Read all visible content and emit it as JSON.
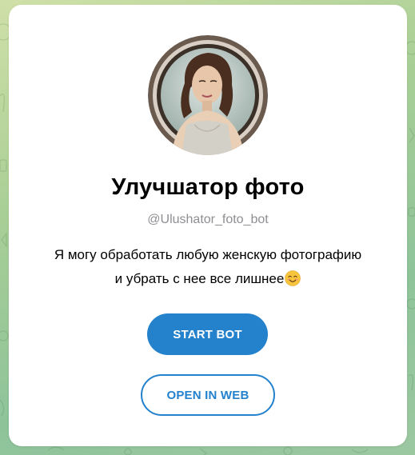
{
  "bot": {
    "name": "Улучшатор фото",
    "username": "@Ulushator_foto_bot",
    "description_line1": "Я могу обработать любую женскую фотографию",
    "description_line2": "и убрать с нее все лишнее"
  },
  "buttons": {
    "start_label": "START BOT",
    "web_label": "OPEN IN WEB"
  },
  "icons": {
    "avatar": "bot-avatar-portrait",
    "emoji": "smiling-face-emoji"
  },
  "colors": {
    "accent": "#2481cc",
    "username": "#8e8e93",
    "card": "#ffffff",
    "background": "#a9cf96"
  }
}
